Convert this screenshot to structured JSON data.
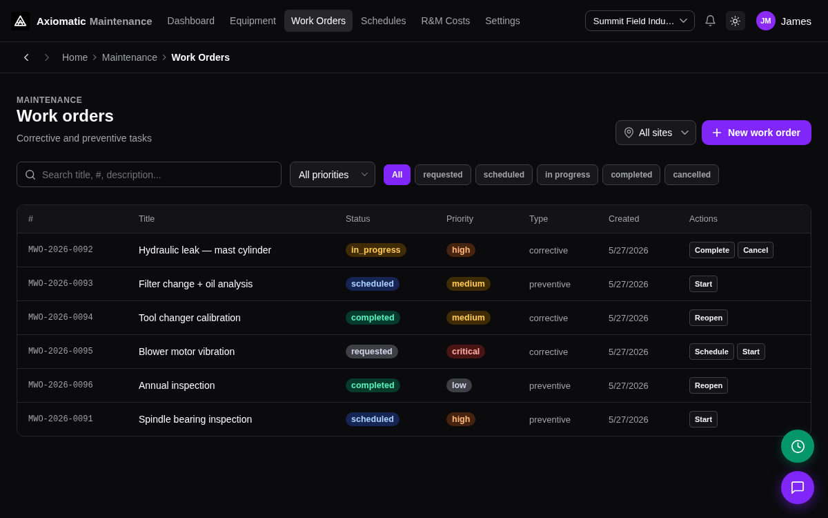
{
  "app": {
    "brand": {
      "name": "Axiomatic",
      "product": "Maintenance"
    },
    "nav": [
      {
        "label": "Dashboard",
        "selected": false
      },
      {
        "label": "Equipment",
        "selected": false
      },
      {
        "label": "Work Orders",
        "selected": true
      },
      {
        "label": "Schedules",
        "selected": false
      },
      {
        "label": "R&M Costs",
        "selected": false
      },
      {
        "label": "Settings",
        "selected": false
      }
    ],
    "org_select": {
      "value": "Summit Field Indu…"
    },
    "user": {
      "initials": "JM",
      "name": "James"
    }
  },
  "breadcrumb": {
    "history": [
      {
        "kind": "back",
        "disabled": false
      },
      {
        "kind": "forward",
        "disabled": true
      }
    ],
    "items": [
      "Home",
      "Maintenance",
      "Work Orders"
    ]
  },
  "page": {
    "eyebrow": "MAINTENANCE",
    "title": "Work orders",
    "subtitle": "Corrective and preventive tasks",
    "site_select": {
      "value": "All sites"
    },
    "new_button": {
      "label": "New work order"
    }
  },
  "filters": {
    "search": {
      "placeholder": "Search title, #, description..."
    },
    "priority_select": {
      "value": "All priorities"
    },
    "status_chips": [
      {
        "label": "All",
        "selected": true
      },
      {
        "label": "requested",
        "selected": false
      },
      {
        "label": "scheduled",
        "selected": false
      },
      {
        "label": "in progress",
        "selected": false
      },
      {
        "label": "completed",
        "selected": false
      },
      {
        "label": "cancelled",
        "selected": false
      }
    ]
  },
  "table": {
    "columns": [
      "#",
      "Title",
      "Status",
      "Priority",
      "Type",
      "Created",
      "Actions"
    ],
    "rows": [
      {
        "number": "MWO-2026-0092",
        "title": "Hydraulic leak — mast cylinder",
        "status": {
          "label": "in_progress",
          "color": "#3f2c06"
        },
        "priority": {
          "label": "high",
          "color": "#45230f"
        },
        "type": "corrective",
        "created": "5/27/2026",
        "actions": [
          "Complete",
          "Cancel"
        ]
      },
      {
        "number": "MWO-2026-0093",
        "title": "Filter change + oil analysis",
        "status": {
          "label": "scheduled",
          "color": "#172554"
        },
        "priority": {
          "label": "medium",
          "color": "#3f2c06"
        },
        "type": "preventive",
        "created": "5/27/2026",
        "actions": [
          "Start"
        ]
      },
      {
        "number": "MWO-2026-0094",
        "title": "Tool changer calibration",
        "status": {
          "label": "completed",
          "color": "#063a2a"
        },
        "priority": {
          "label": "medium",
          "color": "#3f2c06"
        },
        "type": "corrective",
        "created": "5/27/2026",
        "actions": [
          "Reopen"
        ]
      },
      {
        "number": "MWO-2026-0095",
        "title": "Blower motor vibration",
        "status": {
          "label": "requested",
          "color": "#3f3f46"
        },
        "priority": {
          "label": "critical",
          "color": "#4a1414"
        },
        "type": "corrective",
        "created": "5/27/2026",
        "actions": [
          "Schedule",
          "Start"
        ]
      },
      {
        "number": "MWO-2026-0096",
        "title": "Annual inspection",
        "status": {
          "label": "completed",
          "color": "#063a2a"
        },
        "priority": {
          "label": "low",
          "color": "#3f3f46"
        },
        "type": "preventive",
        "created": "5/27/2026",
        "actions": [
          "Reopen"
        ]
      },
      {
        "number": "MWO-2026-0091",
        "title": "Spindle bearing inspection",
        "status": {
          "label": "scheduled",
          "color": "#172554"
        },
        "priority": {
          "label": "high",
          "color": "#45230f"
        },
        "type": "preventive",
        "created": "5/27/2026",
        "actions": [
          "Start"
        ]
      }
    ]
  }
}
